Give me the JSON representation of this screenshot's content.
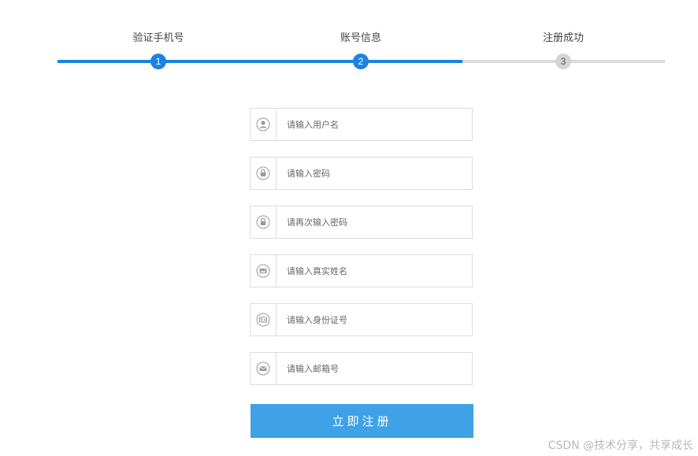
{
  "steps": [
    {
      "label": "验证手机号",
      "number": "1",
      "state": "done"
    },
    {
      "label": "账号信息",
      "number": "2",
      "state": "current"
    },
    {
      "label": "注册成功",
      "number": "3",
      "state": "pending"
    }
  ],
  "colors": {
    "accent": "#1a84e0",
    "button": "#3fa1e6",
    "inactive": "#d4d4d4",
    "border": "#dddddd"
  },
  "form": {
    "fields": [
      {
        "icon": "user-icon",
        "placeholder": "请输入用户名",
        "value": ""
      },
      {
        "icon": "lock-icon",
        "placeholder": "请输入密码",
        "value": ""
      },
      {
        "icon": "lock-icon",
        "placeholder": "请再次输入密码",
        "value": ""
      },
      {
        "icon": "name-card-icon",
        "placeholder": "请输入真实姓名",
        "value": ""
      },
      {
        "icon": "id-card-icon",
        "placeholder": "请输入身份证号",
        "value": ""
      },
      {
        "icon": "mail-icon",
        "placeholder": "请输入邮箱号",
        "value": ""
      }
    ],
    "submit_label": "立即注册"
  },
  "watermark": "CSDN @技术分享，共享成长"
}
